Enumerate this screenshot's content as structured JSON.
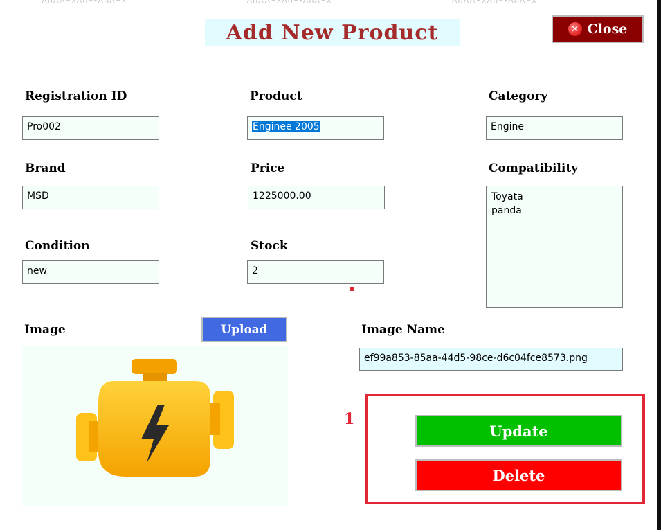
{
  "header": {
    "title": "Add New Product",
    "close_label": "Close",
    "ghost_tabs": [
      "ΔoΔΔΞλΔoΞ•ΔoΔΞλ",
      "ΔoΔΔΞλΔoΞ•ΔoΔΞλ",
      "ΔoΔΔΞλΔoΞ•ΔoΔΞλ"
    ]
  },
  "form": {
    "registration_id": {
      "label": "Registration ID",
      "value": "Pro002"
    },
    "product": {
      "label": "Product",
      "value": "Enginee 2005"
    },
    "category": {
      "label": "Category",
      "value": "Engine"
    },
    "brand": {
      "label": "Brand",
      "value": "MSD"
    },
    "price": {
      "label": "Price",
      "value": "1225000.00"
    },
    "compatibility": {
      "label": "Compatibility",
      "lines": [
        "Toyata",
        "panda"
      ]
    },
    "condition": {
      "label": "Condition",
      "value": "new"
    },
    "stock": {
      "label": "Stock",
      "value": "2"
    },
    "image": {
      "label": "Image",
      "upload_label": "Upload"
    },
    "image_name": {
      "label": "Image Name",
      "value": "ef99a853-85aa-44d5-98ce-d6c04fce8573.png"
    }
  },
  "actions": {
    "update_label": "Update",
    "delete_label": "Delete"
  },
  "annotation": {
    "number": "1"
  },
  "colors": {
    "title_text": "#a52a2a",
    "title_bg": "#e2fbff",
    "close_bg": "#8b0000",
    "upload_bg": "#4169e1",
    "update_bg": "#00c000",
    "delete_bg": "#ff0000",
    "annotation": "#e32636",
    "field_bg": "#f5fffa"
  },
  "icons": {
    "close": "close-icon",
    "preview": "engine-icon"
  }
}
